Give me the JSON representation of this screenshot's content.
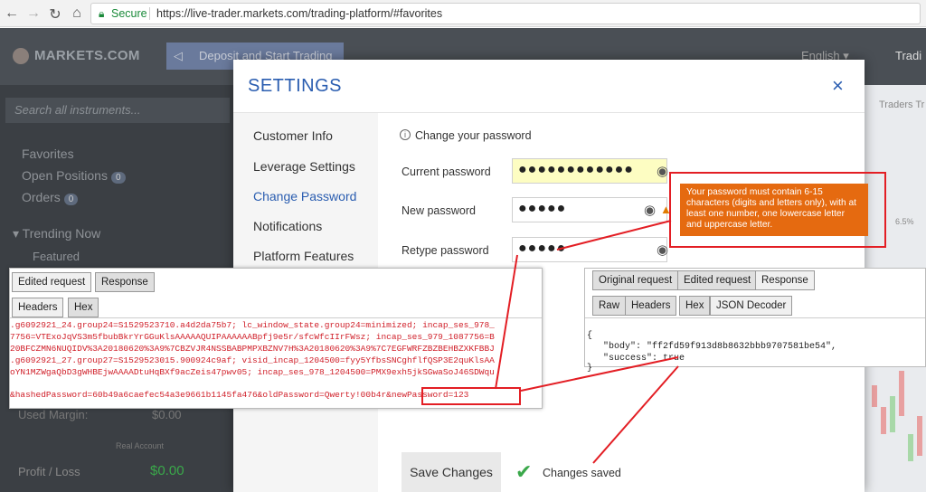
{
  "browser": {
    "secure_label": "Secure",
    "url": "https://live-trader.markets.com/trading-platform/#favorites",
    "icons": [
      "back-icon",
      "forward-icon",
      "reload-icon",
      "home-icon",
      "lock-icon"
    ]
  },
  "app": {
    "logo": "MARKETS.COM",
    "deposit_button": "Deposit and Start Trading",
    "language": "English ▾",
    "trade_label": "Tradi",
    "search_placeholder": "Search all instruments...",
    "nav": {
      "favorites": "Favorites",
      "open_positions": "Open Positions",
      "open_positions_count": "0",
      "orders": "Orders",
      "orders_count": "0",
      "trending_now": "▾ Trending Now",
      "featured": "Featured"
    },
    "used_margin_label": "Used Margin:",
    "used_margin_value": "$0.00",
    "real_account": "Real Account",
    "profit_label": "Profit / Loss",
    "profit_value": "$0.00",
    "traders_tr": "Traders Tr",
    "side_percent": "6.5%"
  },
  "settings": {
    "title": "SETTINGS",
    "close": "×",
    "menu": [
      "Customer Info",
      "Leverage Settings",
      "Change Password",
      "Notifications",
      "Platform Features"
    ],
    "active_menu_index": 2,
    "info_heading": "Change your password",
    "fields": {
      "current_label": "Current password",
      "current_value": "●●●●●●●●●●●●",
      "new_label": "New password",
      "new_value": "●●●●●",
      "retype_label": "Retype password",
      "retype_value": "●●●●●"
    },
    "save_button": "Save Changes",
    "saved_message": "Changes saved",
    "password_rule": "Your password must contain 6-15 characters (digits and letters only), with at least one number, one lowercase letter and uppercase letter."
  },
  "burp_request": {
    "tabs": [
      "Edited request",
      "Response"
    ],
    "subtabs": [
      "Headers",
      "Hex"
    ],
    "lines": [
      ".g6092921_24.group24=S1529523710.a4d2da75b7; lc_window_state.group24=minimized; incap_ses_978_",
      "7756=VTExoJqVS3m5fbubBkrYrGGuKlsAAAAAQUIPAAAAAABpfj9e5r/sfcWfcIIrFWsz; incap_ses_979_1087756=B",
      "20BFCZMN6NUQIDV%3A20180620%3A9%7CBZVJR4NSSBABPMPXBZNV7H%3A20180620%3A9%7C7EGFWRFZBZBEHBZXKFBBJ",
      ".g6092921_27.group27=S1529523015.900924c9af; visid_incap_1204500=fyy5YfbsSNCghflfQSP3E2quKlsAA",
      "oYN1MZWgaQbD3gWHBEjwAAAADtuHqBXf9acZeis47pwv05; incap_ses_978_1204500=PMX9exh5jkSGwaSoJ46SDWqu"
    ],
    "body_line": "&hashedPassword=60b49a6caefec54a3e9661b1145fa476&oldPassword=Qwerty!00b4r&newPassword=123"
  },
  "burp_response": {
    "tabs": [
      "Original request",
      "Edited request",
      "Response"
    ],
    "subtabs": [
      "Raw",
      "Headers",
      "Hex",
      "JSON Decoder"
    ],
    "json_open": "{",
    "body_line": "\"body\": \"ff2fd59f913d8b8632bbb9707581be54\",",
    "success_line": "\"success\": true",
    "json_close": "}"
  }
}
